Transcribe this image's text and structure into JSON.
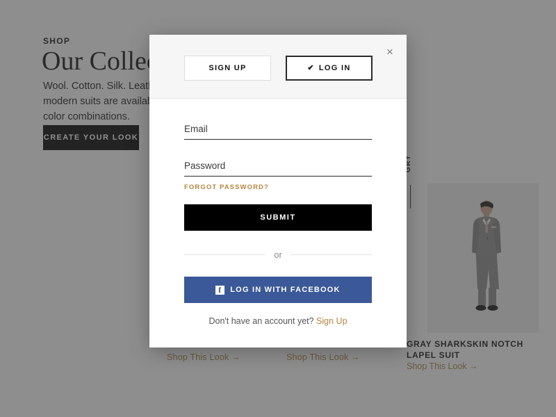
{
  "background": {
    "eyebrow": "SHOP",
    "title": "Our Collection",
    "paragraph": "Wool. Cotton. Silk. Leather. Wedding tuxedos and modern suits are available in hundreds of style and color combinations.",
    "cta_label": "CREATE YOUR LOOK",
    "products": [
      {
        "shop_link": "Shop This Look →"
      },
      {
        "shop_link": "Shop This Look →"
      },
      {
        "category_label": "GRY",
        "title": "GRAY SHARKSKIN NOTCH LAPEL SUIT",
        "shop_link": "Shop This Look →"
      }
    ]
  },
  "modal": {
    "close_label": "×",
    "tabs": [
      {
        "label": "SIGN UP",
        "active": false
      },
      {
        "label": "LOG IN",
        "active": true,
        "check": "✔"
      }
    ],
    "form": {
      "email_placeholder": "Email",
      "email_value": "",
      "password_placeholder": "Password",
      "password_value": "",
      "forgot_label": "FORGOT PASSWORD?",
      "submit_label": "SUBMIT"
    },
    "divider_label": "or",
    "facebook": {
      "glyph": "f",
      "label": "LOG IN WITH FACEBOOK"
    },
    "footer": {
      "text": "Don't have an account yet? ",
      "link": "Sign Up"
    }
  },
  "colors": {
    "accent_gold": "#b5853f",
    "facebook_blue": "#3b5998",
    "overlay": "#3c3c3c",
    "black": "#000000"
  }
}
